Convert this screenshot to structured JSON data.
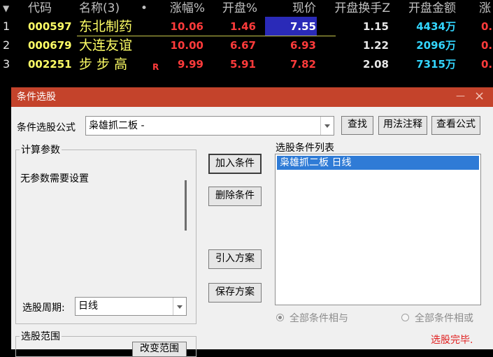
{
  "table": {
    "headers": {
      "code": "代码",
      "name": "名称(3)",
      "dot": "•",
      "change_pct": "涨幅%",
      "open_pct": "开盘%",
      "price": "现价",
      "open_turnover": "开盘换手Z",
      "open_amount": "开盘金额",
      "extra": "涨"
    },
    "rows": [
      {
        "index": "1",
        "code": "000597",
        "name": "东北制药",
        "flag": "",
        "change_pct": "10.06",
        "open_pct": "1.46",
        "price": "7.55",
        "open_turnover": "1.15",
        "open_amount": "4434万",
        "extra": "0."
      },
      {
        "index": "2",
        "code": "000679",
        "name": "大连友谊",
        "flag": "",
        "change_pct": "10.00",
        "open_pct": "6.67",
        "price": "6.93",
        "open_turnover": "1.22",
        "open_amount": "2096万",
        "extra": "0."
      },
      {
        "index": "3",
        "code": "002251",
        "name": "步 步 高",
        "flag": "R",
        "change_pct": "9.99",
        "open_pct": "5.91",
        "price": "7.82",
        "open_turnover": "2.08",
        "open_amount": "7315万",
        "extra": "0."
      }
    ]
  },
  "dialog": {
    "title": "条件选股",
    "minimize": "—",
    "close": "×",
    "formula_label": "条件选股公式",
    "formula_value": "枭雄抓二板  -",
    "find_button": "查找",
    "usage_button": "用法注释",
    "view_button": "查看公式",
    "params_group": "计算参数",
    "no_params": "无参数需要设置",
    "add_button": "加入条件",
    "delete_button": "删除条件",
    "import_button": "引入方案",
    "save_button": "保存方案",
    "list_title": "选股条件列表",
    "list_items": [
      "枭雄抓二板  日线"
    ],
    "period_label": "选股周期:",
    "period_value": "日线",
    "radio_and": "全部条件相与",
    "radio_or": "全部条件相或",
    "range_group": "选股范围",
    "range_button": "改变范围",
    "status": "选股完毕."
  }
}
